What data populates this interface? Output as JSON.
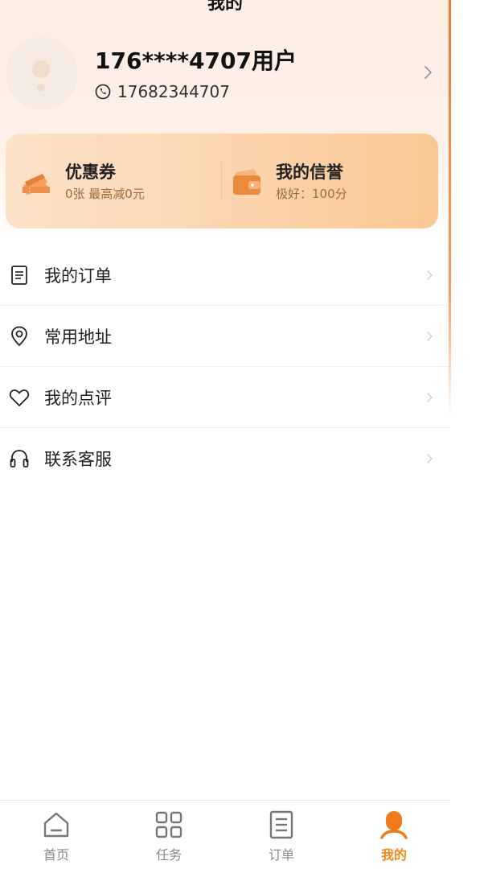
{
  "page": {
    "title": "我的"
  },
  "profile": {
    "username": "176****4707用户",
    "phone": "17682344707"
  },
  "benefits": {
    "coupon": {
      "title": "优惠券",
      "subtitle": "0张 最高减0元"
    },
    "credit": {
      "title": "我的信誉",
      "subtitle": "极好：100分"
    }
  },
  "menu": {
    "items": [
      {
        "label": "我的订单",
        "icon": "document-icon"
      },
      {
        "label": "常用地址",
        "icon": "location-pin-icon"
      },
      {
        "label": "我的点评",
        "icon": "heart-icon"
      },
      {
        "label": "联系客服",
        "icon": "headset-icon"
      }
    ]
  },
  "tabbar": {
    "tabs": [
      {
        "label": "首页",
        "icon": "home-icon"
      },
      {
        "label": "任务",
        "icon": "grid-icon"
      },
      {
        "label": "订单",
        "icon": "document-icon"
      },
      {
        "label": "我的",
        "icon": "person-icon",
        "active": true
      }
    ]
  },
  "colors": {
    "accent": "#f08a1c",
    "card_start": "#fde2c8",
    "card_end": "#f9c893",
    "header_bg": "#fdeee4"
  }
}
